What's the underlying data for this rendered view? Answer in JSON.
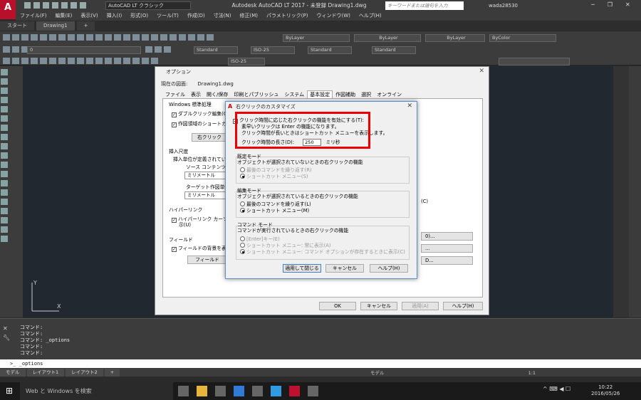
{
  "app": {
    "logo": "A",
    "workspace": "AutoCAD LT クラシック",
    "title": "Autodesk AutoCAD LT 2017 - 未登録    Drawing1.dwg",
    "search_placeholder": "キーワードまたは語句を入力",
    "user": "wada28530",
    "menu": [
      "ファイル(F)",
      "編集(E)",
      "表示(V)",
      "挿入(I)",
      "形式(O)",
      "ツール(T)",
      "作成(D)",
      "寸法(N)",
      "修正(M)",
      "パラメトリック(P)",
      "ウィンドウ(W)",
      "ヘルプ(H)"
    ],
    "tabs": [
      "スタート",
      "Drawing1",
      "+"
    ]
  },
  "ribbon": {
    "layer": "ByLayer",
    "linetype": "ByLayer",
    "lineweight": "ByLayer",
    "color": "ByColor",
    "textstyle": "Standard",
    "dimstyle": "ISO-25",
    "tablestyle": "Standard",
    "mleaderstyle": "Standard",
    "layer_current": "0",
    "dimstyle2": "ISO-25"
  },
  "options_dialog": {
    "title": "オプション",
    "profile_label": "現在の図面:",
    "profile_value": "Drawing1.dwg",
    "tabs": [
      "ファイル",
      "表示",
      "開く/保存",
      "印刷とパブリッシュ",
      "システム",
      "基本設定",
      "作図補助",
      "選択",
      "オンライン"
    ],
    "active_tab": "基本設定",
    "windows_group": "Windows 標準処理",
    "dblclick": "ダブルクリック編集(O)",
    "shortcut": "作図領域のショートカ",
    "rightclick_btn": "右クリック",
    "insert_group": "挿入尺度",
    "insert_desc": "挿入単位が定義されてい",
    "source_label": "ソース コンテンツ単",
    "source_value": "ミリメートル",
    "target_label": "ターゲット作図単位",
    "target_value": "ミリメートル",
    "hyperlink_group": "ハイパーリンク",
    "hyperlink_chk": "ハイパーリンク カーソル",
    "hyperlink_chk2": "示(U)",
    "field_group": "フィールド",
    "field_chk": "フィールドの背景を表",
    "field_btn": "フィールド",
    "right_btn1": "0)...",
    "right_frag": "(C)",
    "right_btn2": "...",
    "right_btn3": "D...",
    "ok": "OK",
    "cancel": "キャンセル",
    "apply": "適用(A)",
    "help": "ヘルプ(H)"
  },
  "rc_dialog": {
    "title": "右クリックのカスタマイズ",
    "timesensitive": "クリック時間に応じた右クリックの機能を有効にする(T):",
    "line1": "素早いクリックは Enter の機能になります。",
    "line2": "クリック時間が長いときはショートカット メニューを表示します。",
    "duration_label": "クリック時間の長さ(D):",
    "duration_value": "250",
    "duration_unit": "ミリ秒",
    "default_group": "既定モード",
    "default_desc": "オブジェクトが選択されていないときの右クリックの機能",
    "default_opt1": "最後のコマンドを繰り返す(R)",
    "default_opt2": "ショートカット メニュー(S)",
    "edit_group": "編集モード",
    "edit_desc": "オブジェクトが選択されているときの右クリックの機能",
    "edit_opt1": "最後のコマンドを繰り返す(L)",
    "edit_opt2": "ショートカット メニュー(M)",
    "cmd_group": "コマンド モード",
    "cmd_desc": "コマンドが実行されているときの右クリックの機能",
    "cmd_opt1": "[Enter]キー(E)",
    "cmd_opt2": "ショートカット メニュー: 常に表示(A)",
    "cmd_opt3": "ショートカット メニュー: コマンド オプションが存在するときに表示(C)",
    "apply_close": "適用して閉じる",
    "cancel": "キャンセル",
    "help": "ヘルプ(H)"
  },
  "command": {
    "lines": [
      "コマンド:",
      "コマンド:",
      "コマンド: _options",
      "コマンド:",
      "コマンド:"
    ],
    "input": "_options",
    "layouts": [
      "モデル",
      "レイアウト1",
      "レイアウト2",
      "+"
    ]
  },
  "statusbar": {
    "model": "モデル",
    "scale": "1:1"
  },
  "taskbar": {
    "search": "Web と Windows を検索",
    "time": "10:22",
    "date": "2016/05/26"
  },
  "ucs": {
    "y": "Y",
    "x": "X"
  }
}
